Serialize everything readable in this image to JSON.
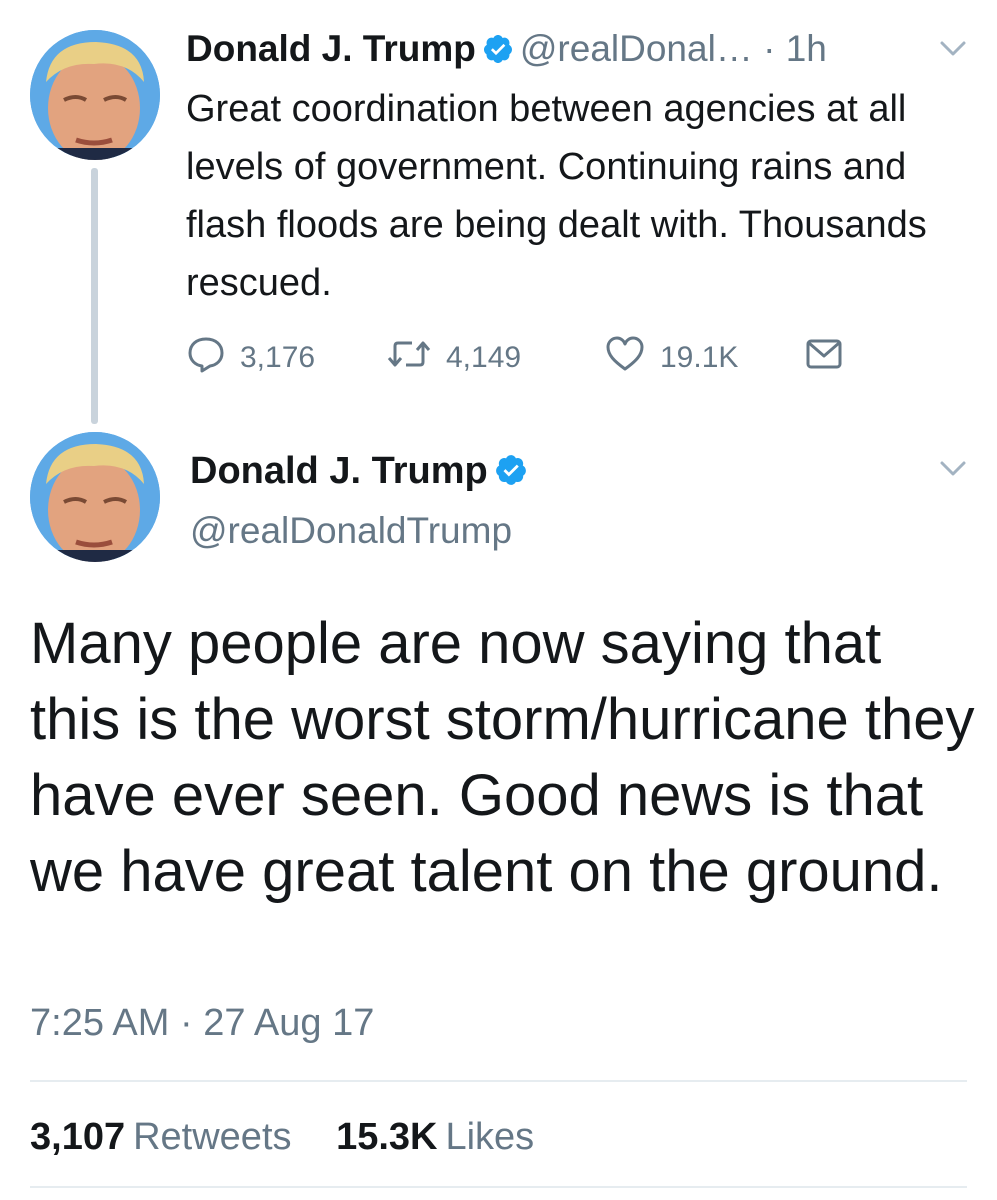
{
  "top_tweet": {
    "name": "Donald J. Trump",
    "handle_truncated": "@realDonal…",
    "separator": "·",
    "time": "1h",
    "text": "Great coordination between agencies at all levels of government. Continuing rains and flash floods are being dealt with. Thousands rescued.",
    "replies": "3,176",
    "retweets": "4,149",
    "likes": "19.1K"
  },
  "main_tweet": {
    "name": "Donald J. Trump",
    "handle": "@realDonaldTrump",
    "text": "Many people are now saying that this is the worst storm/hurricane they have ever seen. Good news is that we have great talent on the ground.",
    "timestamp": "7:25 AM · 27 Aug 17",
    "retweet_count": "3,107",
    "retweet_label": "Retweets",
    "like_count": "15.3K",
    "like_label": "Likes"
  },
  "colors": {
    "verified": "#1da1f2",
    "secondary_text": "#657786",
    "primary_text": "#14171a",
    "thread_line": "#c9d3dc"
  },
  "icons": [
    "reply-icon",
    "retweet-icon",
    "like-icon",
    "direct-message-icon",
    "chevron-down-icon",
    "verified-badge-icon"
  ]
}
